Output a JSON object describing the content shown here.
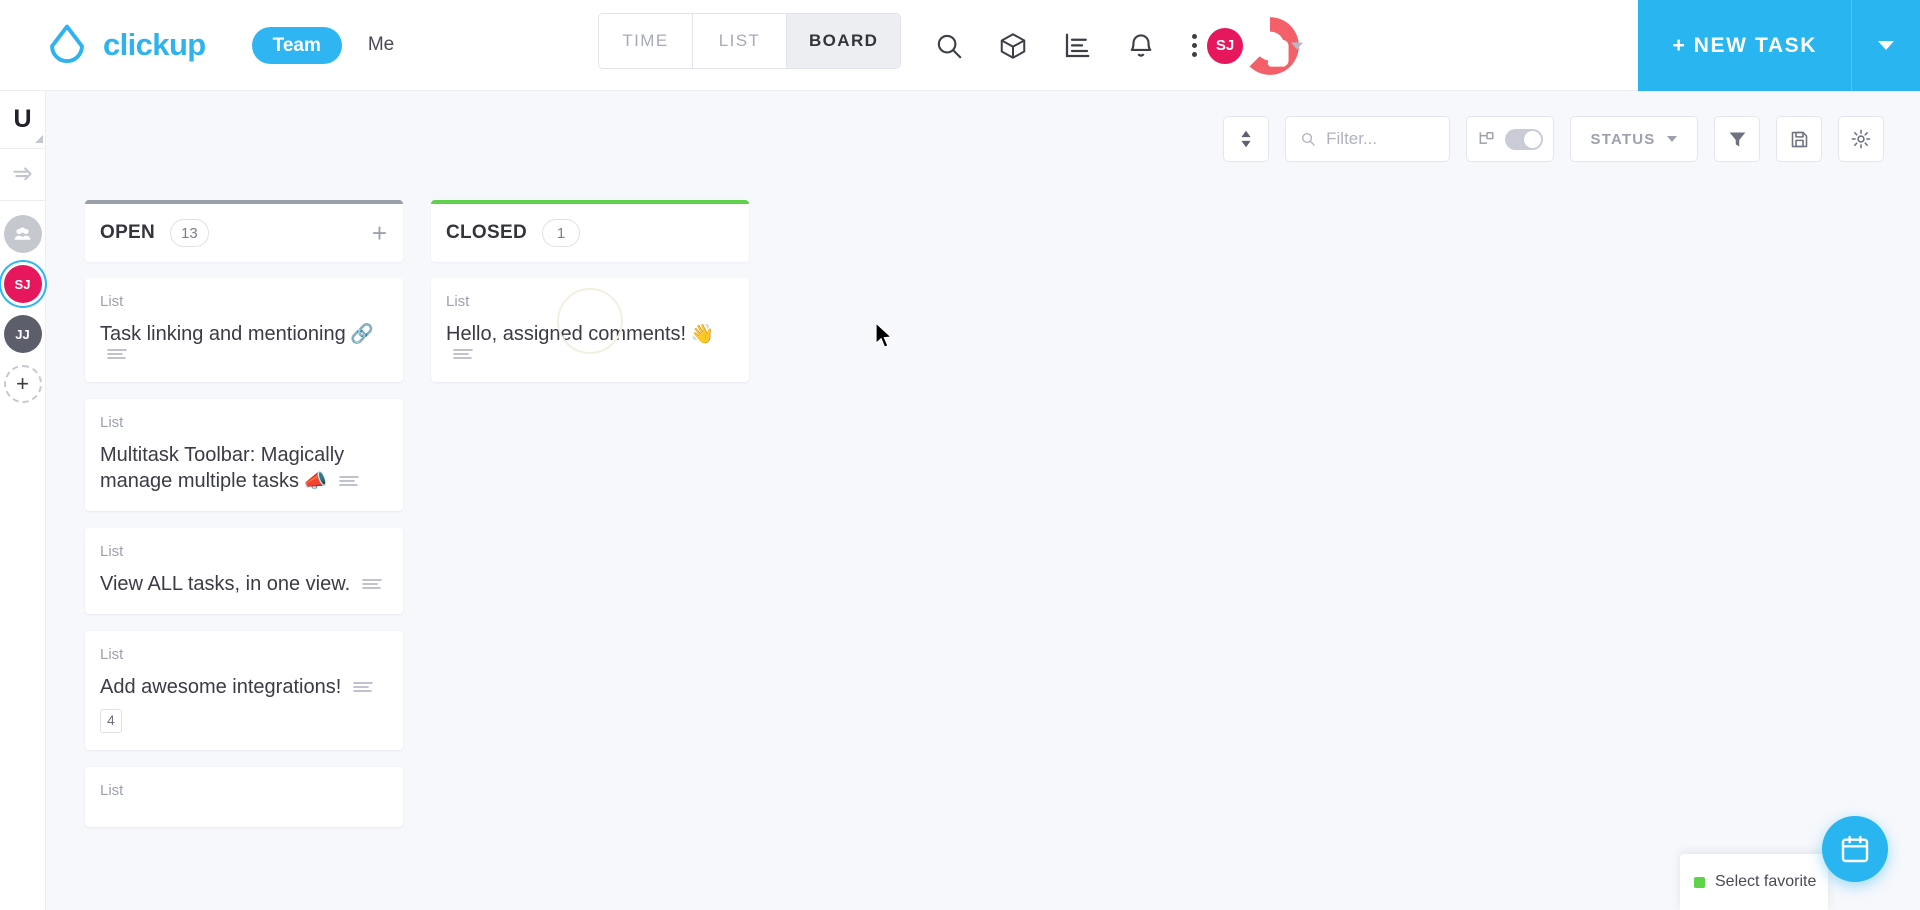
{
  "header": {
    "logo_text": "clickup",
    "team_label": "Team",
    "me_label": "Me",
    "view_tabs": [
      {
        "label": "TIME",
        "active": false
      },
      {
        "label": "LIST",
        "active": false
      },
      {
        "label": "BOARD",
        "active": true
      }
    ],
    "icons": [
      "search-icon",
      "cube-icon",
      "chart-icon",
      "bell-icon",
      "more-vertical-icon"
    ],
    "avatar_initials": "SJ",
    "new_task_label": "+ NEW TASK",
    "accent_color": "#29b6f0",
    "avatar_color": "#e6175c"
  },
  "rail": {
    "workspace_initial": "U",
    "collapse_icon": "collapse-arrow-icon",
    "avatars": [
      {
        "name": "group-avatar",
        "initials": "",
        "type": "group"
      },
      {
        "name": "avatar-sj",
        "initials": "SJ",
        "type": "sj",
        "active": true
      },
      {
        "name": "avatar-jj",
        "initials": "JJ",
        "type": "jj"
      },
      {
        "name": "add-member",
        "initials": "+",
        "type": "add"
      }
    ]
  },
  "toolbar": {
    "sort_icon": "sort-icon",
    "filter_placeholder": "Filter...",
    "filter_value": "",
    "subtask_icon": "subtask-icon",
    "subtask_toggle_on": false,
    "status_label": "STATUS",
    "funnel_icon": "funnel-icon",
    "save_icon": "save-icon",
    "settings_icon": "gear-icon"
  },
  "board": {
    "columns": [
      {
        "title": "OPEN",
        "count": "13",
        "bar_color": "#9aa0ab",
        "add_label": "+",
        "cards": [
          {
            "list": "List",
            "title": "Task linking and mentioning",
            "emoji": "🔗",
            "badge": ""
          },
          {
            "list": "List",
            "title": "Multitask Toolbar: Magically manage multiple tasks",
            "emoji": "📣",
            "badge": ""
          },
          {
            "list": "List",
            "title": "View ALL tasks, in one view.",
            "emoji": "",
            "badge": ""
          },
          {
            "list": "List",
            "title": "Add awesome integrations!",
            "emoji": "",
            "badge": "4"
          },
          {
            "list": "List",
            "title": "",
            "emoji": "",
            "badge": ""
          }
        ]
      },
      {
        "title": "CLOSED",
        "count": "1",
        "bar_color": "#5ed24b",
        "add_label": "",
        "cards": [
          {
            "list": "List",
            "title": "Hello, assigned comments!",
            "emoji": "👋",
            "badge": ""
          }
        ]
      }
    ]
  },
  "footer": {
    "favorite_label": "Select favorite",
    "favorite_dot_color": "#5ed24b",
    "fab_icon": "calendar-icon"
  }
}
